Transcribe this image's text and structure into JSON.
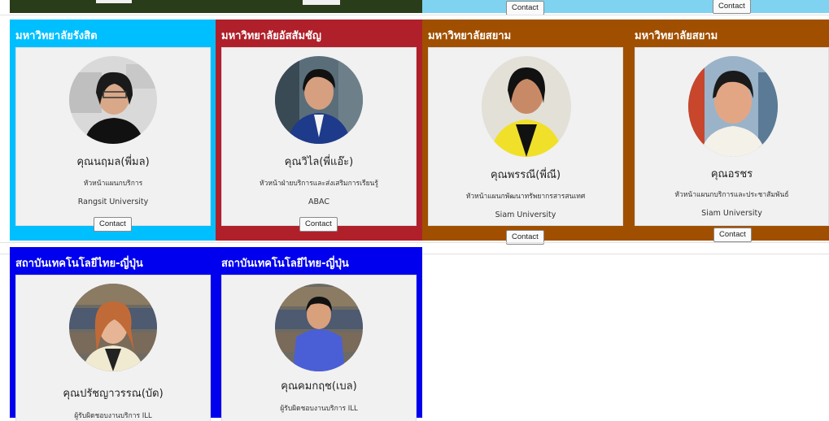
{
  "colors": {
    "dark_green": "#2a3d1a",
    "sky": "#00bfff",
    "light_sky": "#7fd3f0",
    "crimson": "#b0202a",
    "brown": "#a04f00",
    "blue": "#0000ee"
  },
  "top_row": {
    "contact_label_1": "Contact",
    "contact_label_2": "Contact"
  },
  "row1": [
    {
      "title": "มหาวิทยาลัยรังสิต",
      "name": "คุณนฤมล(พี่มล)",
      "role": "หัวหน้าแผนกบริการ",
      "university": "Rangsit University",
      "contact": "Contact",
      "avatar": "woman-with-glasses-photo"
    },
    {
      "title": "มหาวิทยาลัยอัสสัมชัญ",
      "name": "คุณวิไล(พี่แอ๊ะ)",
      "role": "หัวหน้าฝ่ายบริการและส่งเสริมการเรียนรู้",
      "university": "ABAC",
      "contact": "Contact",
      "avatar": "woman-short-hair-photo"
    },
    {
      "title": "มหาวิทยาลัยสยาม",
      "name": "คุณพรรณี(พี่ณี)",
      "role": "หัวหน้าแผนกพัฒนาทรัพยากรสารสนเทศ",
      "university": "Siam University",
      "contact": "Contact",
      "avatar": "woman-yellow-jacket-photo"
    },
    {
      "title": "มหาวิทยาลัยสยาม",
      "name": "คุณอรชร",
      "role": "หัวหน้าแผนกบริการและประชาสัมพันธ์",
      "university": "Siam University",
      "contact": "Contact",
      "avatar": "woman-bookshelf-photo"
    }
  ],
  "row2": [
    {
      "title": "สถาบันเทคโนโลยีไทย-ญี่ปุ่น",
      "name": "คุณปรัชญาวรรณ(บัด)",
      "role": "ผู้รับผิดชอบงานบริการ ILL",
      "avatar": "woman-library-photo"
    },
    {
      "title": "สถาบันเทคโนโลยีไทย-ญี่ปุ่น",
      "name": "คุณคมกฤช(เบล)",
      "role": "ผู้รับผิดชอบงานบริการ ILL",
      "avatar": "man-blue-shirt-photo"
    }
  ]
}
